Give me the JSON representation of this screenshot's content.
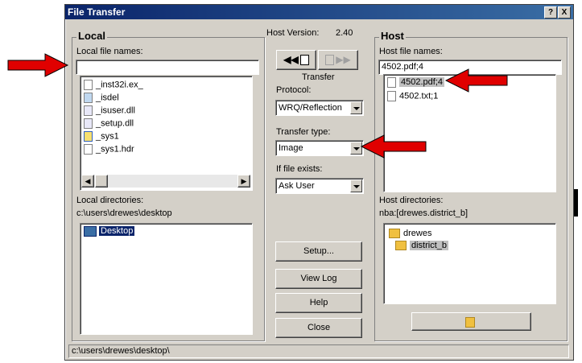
{
  "window": {
    "title": "File Transfer",
    "help_label": "?",
    "close_label": "X"
  },
  "local": {
    "group_title": "Local",
    "file_names_label": "Local file names:",
    "file_input": "",
    "files": [
      {
        "name": "_inst32i.ex_",
        "icon": "file-icon"
      },
      {
        "name": "_isdel",
        "icon": "exe-icon"
      },
      {
        "name": "_isuser.dll",
        "icon": "dll-icon"
      },
      {
        "name": "_setup.dll",
        "icon": "dll-icon"
      },
      {
        "name": "_sys1",
        "icon": "app-icon"
      },
      {
        "name": "_sys1.hdr",
        "icon": "file-icon"
      }
    ],
    "dirs_label": "Local directories:",
    "dir_path": "c:\\users\\drewes\\desktop",
    "dirs": [
      {
        "name": "Desktop",
        "selected": true
      }
    ]
  },
  "center": {
    "host_version_label": "Host Version:",
    "host_version": "2.40",
    "transfer_label": "Transfer",
    "protocol_label": "Protocol:",
    "protocol_value": "WRQ/Reflection",
    "transfer_type_label": "Transfer type:",
    "transfer_type_value": "Image",
    "if_exists_label": "If file exists:",
    "if_exists_value": "Ask User",
    "buttons": {
      "setup": "Setup...",
      "view_log": "View Log",
      "help": "Help",
      "close": "Close"
    }
  },
  "host": {
    "group_title": "Host",
    "file_names_label": "Host file names:",
    "file_input": "4502.pdf;4",
    "files": [
      {
        "name": "4502.pdf;4",
        "selected": true
      },
      {
        "name": "4502.txt;1",
        "selected": false
      }
    ],
    "dirs_label": "Host directories:",
    "dir_path": "nba:[drewes.district_b]",
    "dirs": [
      {
        "name": "drewes"
      },
      {
        "name": "district_b",
        "selected": true
      }
    ]
  },
  "status_bar": {
    "text": "c:\\users\\drewes\\desktop\\"
  },
  "colors": {
    "annotation_arrow": "#e00000",
    "selection": "#0a246a",
    "face": "#d4d0c8"
  }
}
